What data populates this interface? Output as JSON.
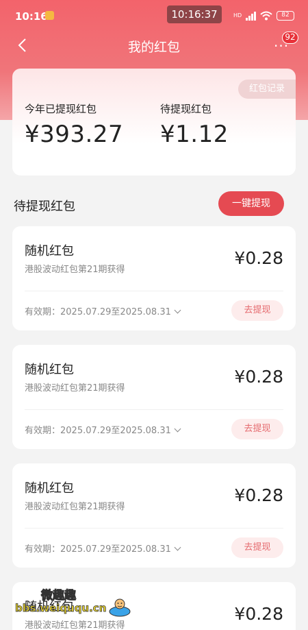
{
  "status_bar": {
    "time": "10:16",
    "center_clock": "10:16:37",
    "hd_label": "HD",
    "battery": "82"
  },
  "nav": {
    "title": "我的红包",
    "more_label": "···",
    "badge_count": "92"
  },
  "summary": {
    "record_button": "红包记录",
    "withdrawn_label": "今年已提现红包",
    "withdrawn_value": "¥393.27",
    "pending_label": "待提现红包",
    "pending_value": "¥1.12"
  },
  "section": {
    "title": "待提现红包",
    "withdraw_all_label": "一键提现"
  },
  "packets": [
    {
      "type": "随机红包",
      "source": "港股波动红包第21期获得",
      "amount": "¥0.28",
      "validity": "有效期：2025.07.29至2025.08.31",
      "action": "去提现"
    },
    {
      "type": "随机红包",
      "source": "港股波动红包第21期获得",
      "amount": "¥0.28",
      "validity": "有效期：2025.07.29至2025.08.31",
      "action": "去提现"
    },
    {
      "type": "随机红包",
      "source": "港股波动红包第21期获得",
      "amount": "¥0.28",
      "validity": "有效期：2025.07.29至2025.08.31",
      "action": "去提现"
    },
    {
      "type": "随机红包",
      "source": "港股波动红包第21期获得",
      "amount": "¥0.28",
      "validity": "",
      "action": ""
    }
  ],
  "watermark": {
    "text_cn": "微趣趣",
    "url": "bbs.weiququ.cn"
  },
  "colors": {
    "header_red": "#f3636b",
    "button_red": "#e54a52",
    "badge_red": "#e8323a",
    "text_dark": "#222222",
    "text_grey": "#888888"
  }
}
